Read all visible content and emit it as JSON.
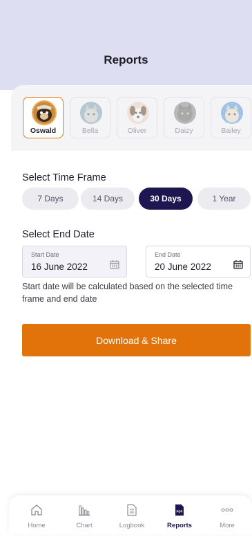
{
  "header": {
    "title": "Reports"
  },
  "pets": [
    {
      "name": "Oswald",
      "selected": true
    },
    {
      "name": "Bella",
      "selected": false
    },
    {
      "name": "Oliver",
      "selected": false
    },
    {
      "name": "Daizy",
      "selected": false
    },
    {
      "name": "Bailey",
      "selected": false
    }
  ],
  "time_frame": {
    "title": "Select Time Frame",
    "options": [
      "7 Days",
      "14 Days",
      "30 Days",
      "1 Year"
    ],
    "selected": "30 Days"
  },
  "end_date": {
    "title": "Select End Date",
    "start_label": "Start Date",
    "start_value": "16 June 2022",
    "end_label": "End Date",
    "end_value": "20 June 2022",
    "helper": "Start date will be calculated based on the selected time frame and end date"
  },
  "download_button": {
    "label": "Download & Share"
  },
  "nav": {
    "items": [
      {
        "label": "Home",
        "icon": "home-icon"
      },
      {
        "label": "Chart",
        "icon": "chart-icon"
      },
      {
        "label": "Logbook",
        "icon": "logbook-icon"
      },
      {
        "label": "Reports",
        "icon": "pdf-icon"
      },
      {
        "label": "More",
        "icon": "more-icon"
      }
    ],
    "active": "Reports",
    "pdf_badge": "PDF"
  },
  "colors": {
    "header_bg": "#dedef2",
    "accent_orange": "#e2720a",
    "active_navy": "#1c1751"
  }
}
